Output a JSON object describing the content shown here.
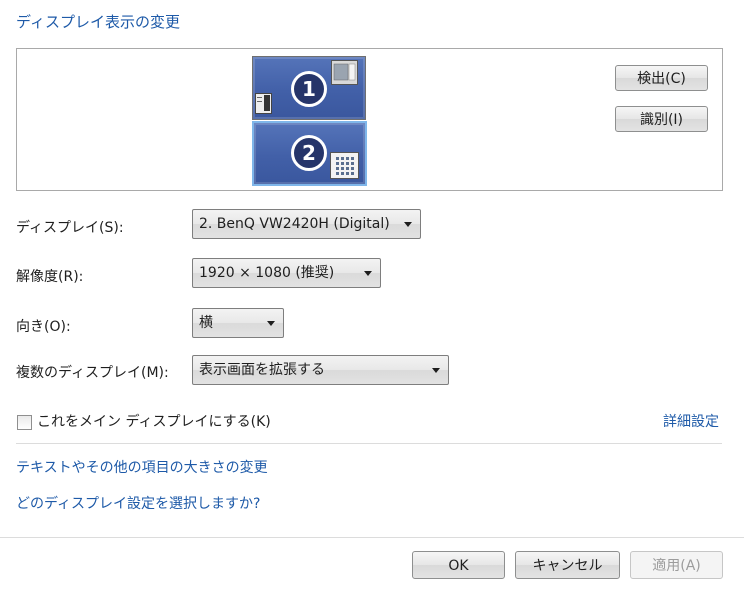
{
  "header": {
    "title": "ディスプレイ表示の変更"
  },
  "monitors": [
    {
      "number": "1",
      "selected": false
    },
    {
      "number": "2",
      "selected": true
    }
  ],
  "side_buttons": {
    "detect": "検出(C)",
    "identify": "識別(I)"
  },
  "settings": {
    "display_label": "ディスプレイ(S):",
    "display_value": "2. BenQ VW2420H (Digital)",
    "resolution_label": "解像度(R):",
    "resolution_value": "1920 × 1080 (推奨)",
    "orientation_label": "向き(O):",
    "orientation_value": "横",
    "multiple_label": "複数のディスプレイ(M):",
    "multiple_value": "表示画面を拡張する"
  },
  "main_display": {
    "label": "これをメイン ディスプレイにする(K)",
    "checked": false
  },
  "links": {
    "advanced": "詳細設定",
    "text_size": "テキストやその他の項目の大きさの変更",
    "which_settings": "どのディスプレイ設定を選択しますか?"
  },
  "footer": {
    "ok": "OK",
    "cancel": "キャンセル",
    "apply": "適用(A)"
  }
}
